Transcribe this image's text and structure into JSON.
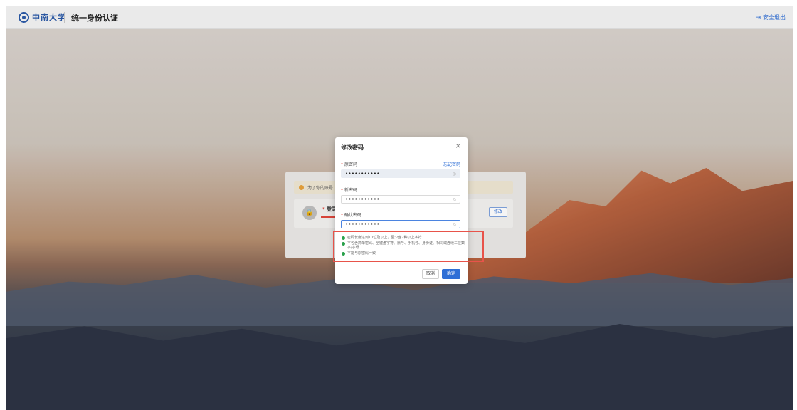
{
  "header": {
    "logo_text": "中南大学",
    "app_title": "统一身份认证",
    "logout_label": "安全退出",
    "logout_icon": "logout-arrow-icon"
  },
  "background_page": {
    "notice": "为了你的账号",
    "login_label": "登录密",
    "modify_button": "修改"
  },
  "modal": {
    "title": "修改密码",
    "close_icon": "×",
    "old_password": {
      "label": "原密码",
      "value": "•••••••••••",
      "forgot_link": "忘记密码"
    },
    "new_password": {
      "label": "新密码",
      "value": "•••••••••••"
    },
    "confirm_password": {
      "label": "确认密码",
      "value": "•••••••••••"
    },
    "rules": [
      "密码长度达到10位及以上，至少含2种以上字符",
      "不包含简单密码、全键盘字符、账号、手机号、身份证、相同或连续三位数字/字母",
      "不能与原密码一致"
    ],
    "cancel_label": "取消",
    "confirm_label": "确定"
  },
  "colors": {
    "accent": "#2f6fd6",
    "required": "#e0483d",
    "check": "#2aa14c",
    "highlight_box": "#e8534a"
  }
}
